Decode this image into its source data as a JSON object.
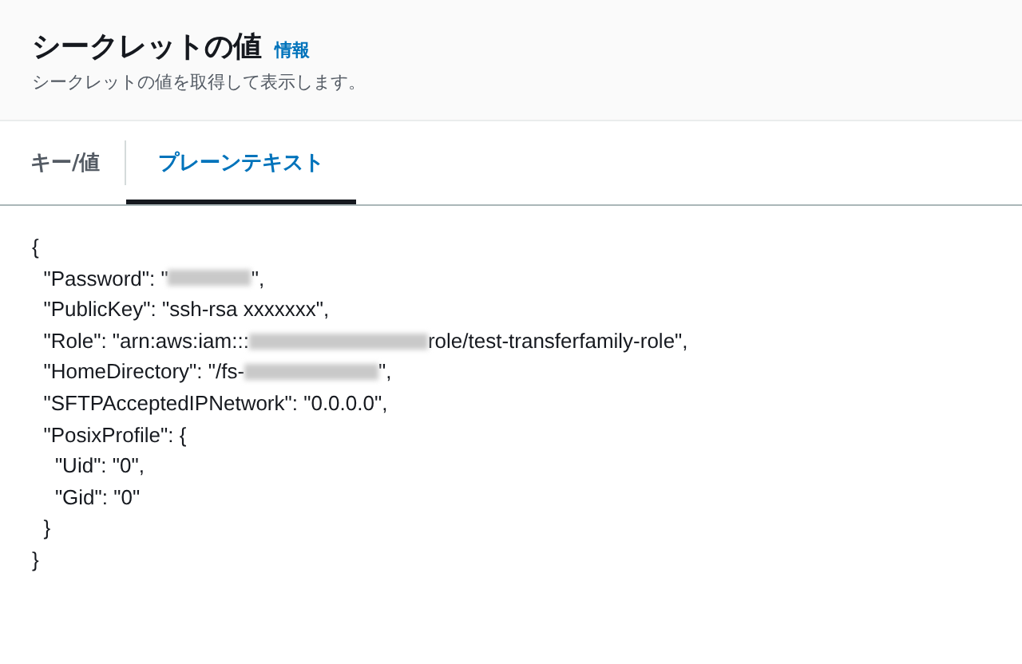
{
  "header": {
    "title": "シークレットの値",
    "info_link": "情報",
    "description": "シークレットの値を取得して表示します。"
  },
  "tabs": [
    {
      "label": "キー/値",
      "selected": false
    },
    {
      "label": "プレーンテキスト",
      "selected": true
    }
  ],
  "secret_text": {
    "lines": [
      [
        {
          "kind": "text",
          "text": "{"
        }
      ],
      [
        {
          "kind": "text",
          "text": "  \"Password\": \""
        },
        {
          "kind": "redacted"
        },
        {
          "kind": "text",
          "text": "\","
        }
      ],
      [
        {
          "kind": "text",
          "text": "  \"PublicKey\": \"ssh-rsa xxxxxxx\","
        }
      ],
      [
        {
          "kind": "text",
          "text": "  \"Role\": \"arn:aws:iam:::"
        },
        {
          "kind": "redacted"
        },
        {
          "kind": "text",
          "text": "role/test-transferfamily-role\","
        }
      ],
      [
        {
          "kind": "text",
          "text": "  \"HomeDirectory\": \"/fs-"
        },
        {
          "kind": "redacted"
        },
        {
          "kind": "text",
          "text": "\","
        }
      ],
      [
        {
          "kind": "text",
          "text": "  \"SFTPAcceptedIPNetwork\": \"0.0.0.0\","
        }
      ],
      [
        {
          "kind": "text",
          "text": "  \"PosixProfile\": {"
        }
      ],
      [
        {
          "kind": "text",
          "text": "    \"Uid\": \"0\","
        }
      ],
      [
        {
          "kind": "text",
          "text": "    \"Gid\": \"0\""
        }
      ],
      [
        {
          "kind": "text",
          "text": "  }"
        }
      ],
      [
        {
          "kind": "text",
          "text": "}"
        }
      ]
    ]
  }
}
